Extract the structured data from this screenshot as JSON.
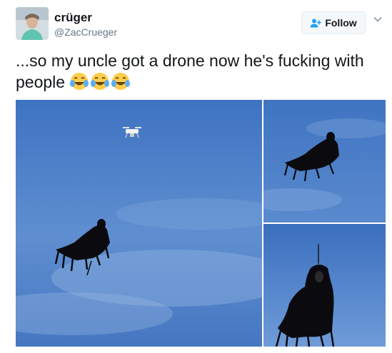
{
  "user": {
    "display_name": "crüger",
    "handle": "@ZacCrueger",
    "avatar_icon": "profile-photo"
  },
  "follow_button": {
    "label": "Follow",
    "icon": "add-user-icon"
  },
  "menu": {
    "icon": "chevron-down-icon"
  },
  "tweet": {
    "text": "...so my uncle got a drone now he's fucking with people",
    "emoji_count": 3,
    "emoji": "face-with-tears-of-joy"
  },
  "media": {
    "count": 3,
    "photos": [
      {
        "subject": "drone-and-dementor-costume"
      },
      {
        "subject": "dementor-costume-flying"
      },
      {
        "subject": "dementor-costume-closeup"
      }
    ]
  },
  "colors": {
    "text": "#14171a",
    "secondary_text": "#657786",
    "follow_icon": "#1da1f2",
    "sky": "#4a7cc4"
  }
}
